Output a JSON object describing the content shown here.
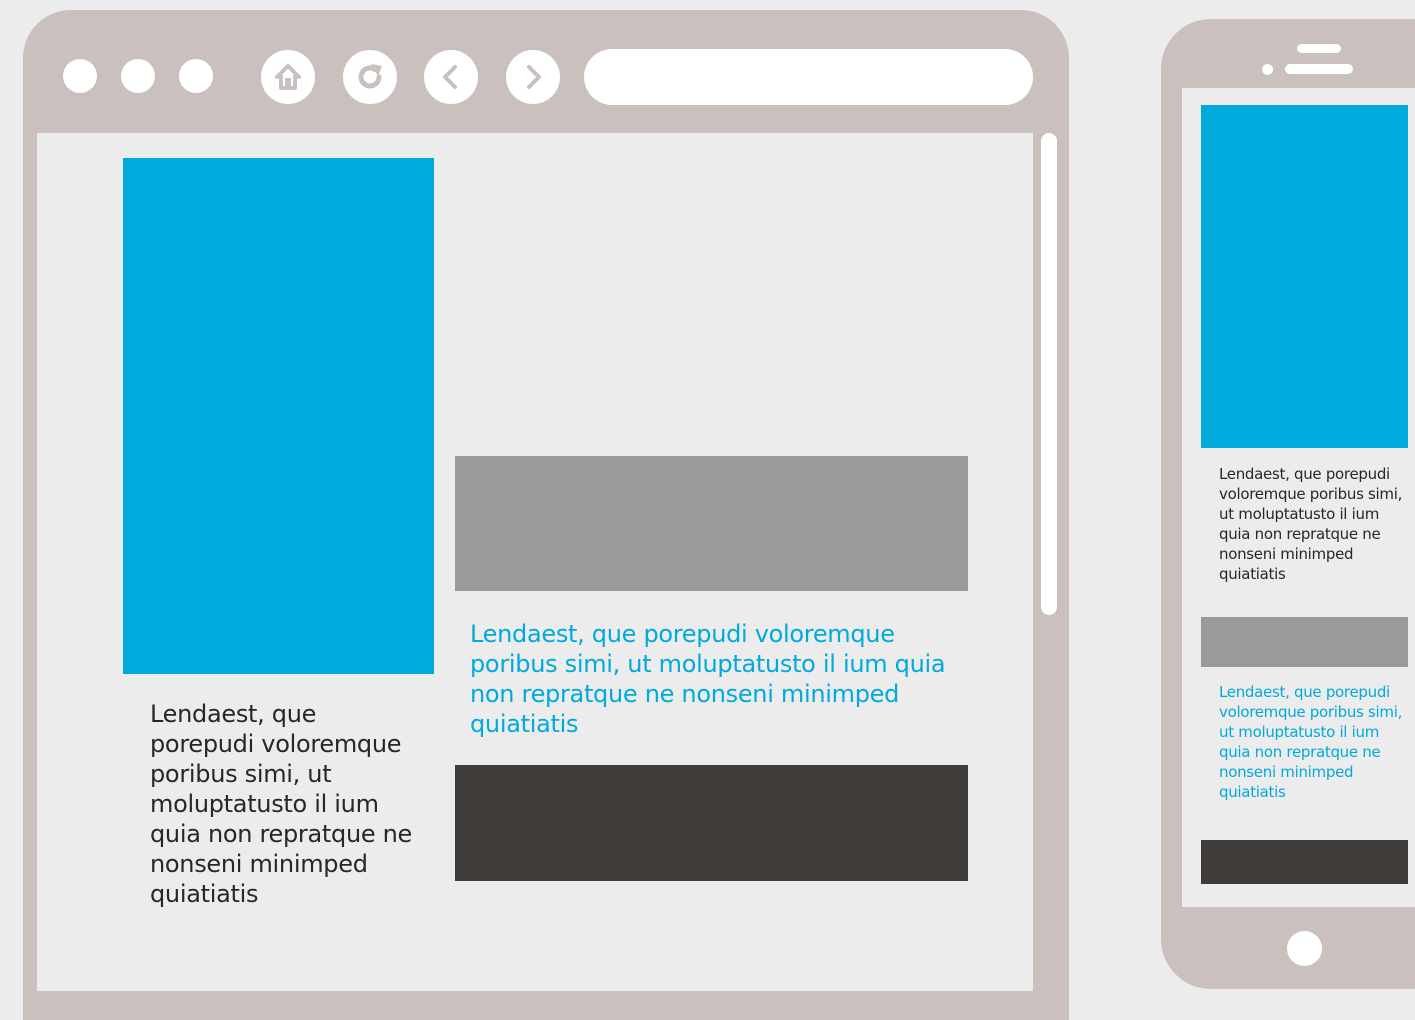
{
  "colors": {
    "frame": "#cac0bd",
    "background": "#ececec",
    "accent": "#00aadc",
    "gray_block": "#9b9a98",
    "dark_block": "#3f3b38",
    "text": "#2a2624"
  },
  "browser": {
    "window_dots": [
      "dot",
      "dot",
      "dot"
    ],
    "nav_icons": [
      "home-icon",
      "refresh-icon",
      "back-arrow-icon",
      "forward-arrow-icon"
    ],
    "address_bar_value": "",
    "body_text": "Lendaest, que porepudi voloremque poribus simi, ut moluptatusto il ium quia non repratque ne nonseni minimped quiatiatis",
    "accent_text": "Lendaest, que porepudi voloremque poribus simi, ut moluptatusto il ium quia non repratque ne nonseni minimped quiatiatis"
  },
  "phone": {
    "body_text": "Lendaest, que porepudi voloremque poribus simi, ut moluptatusto il ium quia non repratque ne nonseni minimped quiatiatis",
    "accent_text": "Lendaest, que porepudi voloremque poribus simi, ut moluptatusto il ium quia non repratque ne nonseni minimped quiatiatis"
  }
}
